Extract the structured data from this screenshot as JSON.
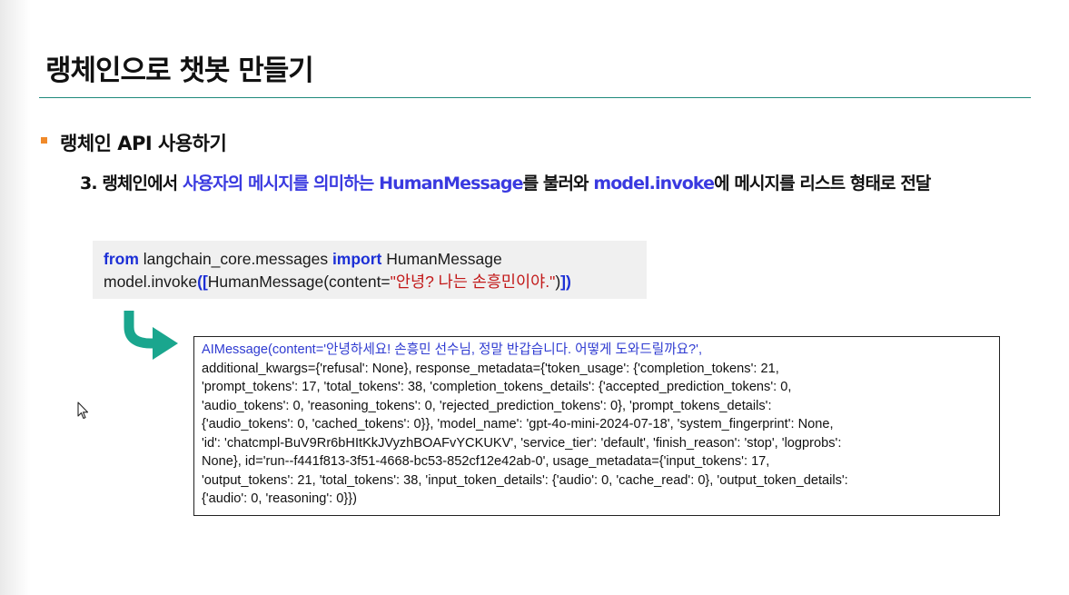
{
  "slide": {
    "title": "랭체인으로 챗봇 만들기",
    "subtitle": "랭체인 API 사용하기",
    "step": {
      "prefix": "3. 랭체인에서 ",
      "highlight1": "사용자의 메시지를 의미하는 HumanMessage",
      "middle": "를 불러와 ",
      "highlight2": "model.invoke",
      "suffix": "에 메시지를 리스트 형태로 전달"
    }
  },
  "code": {
    "line1": {
      "kw_from": "from",
      "module": " langchain_core.messages ",
      "kw_import": "import",
      "name": " HumanMessage"
    },
    "line2": {
      "call": "model.invoke",
      "open": "([",
      "ctor": "HumanMessage(content=",
      "arg": "\"안녕? 나는 손흥민이야.\"",
      "close_paren": ")",
      "close": "])"
    }
  },
  "output": {
    "lines": [
      "AIMessage(content='안녕하세요! 손흥민 선수님, 정말 반갑습니다. 어떻게 도와드릴까요?',",
      "additional_kwargs={'refusal': None}, response_metadata={'token_usage': {'completion_tokens': 21,",
      "'prompt_tokens': 17, 'total_tokens': 38, 'completion_tokens_details': {'accepted_prediction_tokens': 0,",
      "'audio_tokens': 0, 'reasoning_tokens': 0, 'rejected_prediction_tokens': 0}, 'prompt_tokens_details':",
      "{'audio_tokens': 0, 'cached_tokens': 0}}, 'model_name': 'gpt-4o-mini-2024-07-18', 'system_fingerprint': None,",
      "'id': 'chatcmpl-BuV9Rr6bHItKkJVyzhBOAFvYCKUKV', 'service_tier': 'default', 'finish_reason': 'stop', 'logprobs':",
      "None}, id='run--f441f813-3f51-4668-bc53-852cf12e42ab-0', usage_metadata={'input_tokens': 17,",
      "'output_tokens': 21, 'total_tokens': 38, 'input_token_details': {'audio': 0, 'cache_read': 0}, 'output_token_details':",
      "{'audio': 0, 'reasoning': 0}})"
    ]
  },
  "colors": {
    "accent_teal": "#1aa68e",
    "highlight_blue": "#3a3ae0",
    "bullet_orange": "#f08a2a",
    "string_red": "#c21818"
  },
  "icons": {
    "arrow": "curved-arrow-icon",
    "cursor": "mouse-cursor-icon"
  }
}
